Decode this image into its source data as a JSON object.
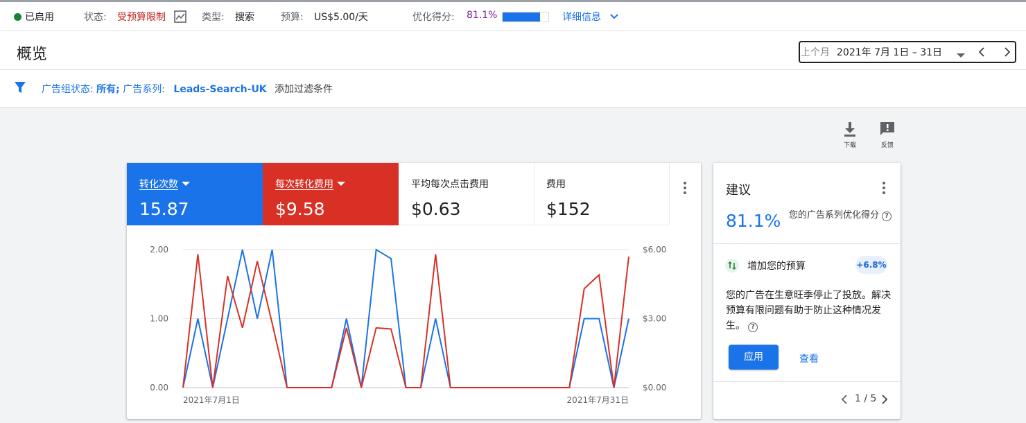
{
  "status_bar": {
    "enabled_label": "已启用",
    "status_label": "状态:",
    "status_value": "受预算限制",
    "type_label": "类型:",
    "type_value": "搜索",
    "budget_label": "预算:",
    "budget_value": "US$5.00/天",
    "score_label": "优化得分:",
    "score_value": "81.1%",
    "score_fraction": 0.811,
    "details_link": "详细信息"
  },
  "header": {
    "title": "概览",
    "date_preset": "上个月",
    "date_range": "2021年 7月 1日 – 31日"
  },
  "filter": {
    "part1_label": "广告组状态:",
    "part1_value": "所有;",
    "part2_label": "广告系列:",
    "part2_value": "Leads-Search-UK",
    "add_filter": "添加过滤条件"
  },
  "toolbar": {
    "download": "下载",
    "feedback": "反馈"
  },
  "metrics": [
    {
      "name": "转化次数",
      "value": "15.87",
      "color": "#1a73e8",
      "selected": true
    },
    {
      "name": "每次转化费用",
      "value": "$9.58",
      "color": "#d93025",
      "selected": true
    },
    {
      "name": "平均每次点击费用",
      "value": "$0.63",
      "selected": false
    },
    {
      "name": "费用",
      "value": "$152",
      "selected": false
    }
  ],
  "chart_data": {
    "type": "line",
    "x_labels": [
      "2021年7月1日",
      "2021年7月31日"
    ],
    "x": [
      1,
      2,
      3,
      4,
      5,
      6,
      7,
      8,
      9,
      10,
      11,
      12,
      13,
      14,
      15,
      16,
      17,
      18,
      19,
      20,
      21,
      22,
      23,
      24,
      25,
      26,
      27,
      28,
      29,
      30,
      31
    ],
    "left_axis": {
      "ticks": [
        "0.00",
        "1.00",
        "2.00"
      ],
      "range": [
        0,
        2
      ]
    },
    "right_axis": {
      "ticks": [
        "$0.00",
        "$3.00",
        "$6.00"
      ],
      "range": [
        0,
        6
      ]
    },
    "series": [
      {
        "name": "转化次数",
        "axis": "left",
        "color": "#1a73e8",
        "values": [
          0,
          1,
          0,
          1,
          2,
          1,
          2,
          0,
          0,
          0,
          0,
          1,
          0,
          2,
          1.87,
          0,
          0,
          1,
          0,
          0,
          0,
          0,
          0,
          0,
          0,
          0,
          0,
          1,
          1,
          0,
          1
        ]
      },
      {
        "name": "每次转化费用",
        "axis": "right",
        "color": "#d93025",
        "values": [
          0,
          5.8,
          0,
          4.85,
          2.6,
          5.5,
          2.8,
          0,
          0,
          0,
          0,
          2.6,
          0,
          2.6,
          2.55,
          0,
          0,
          5.8,
          0,
          0,
          0,
          0,
          0,
          0,
          0,
          0,
          0,
          4.3,
          4.9,
          0,
          5.7
        ]
      }
    ],
    "grid": true
  },
  "recommendations": {
    "title": "建议",
    "score": "81.1%",
    "score_desc": "您的广告系列优化得分",
    "item_title": "增加您的预算",
    "item_badge": "+6.8%",
    "item_desc": "您的广告在生意旺季停止了投放。解决预算有限问题有助于防止这种情况发生。",
    "apply": "应用",
    "view": "查看",
    "pager": "1 / 5"
  }
}
